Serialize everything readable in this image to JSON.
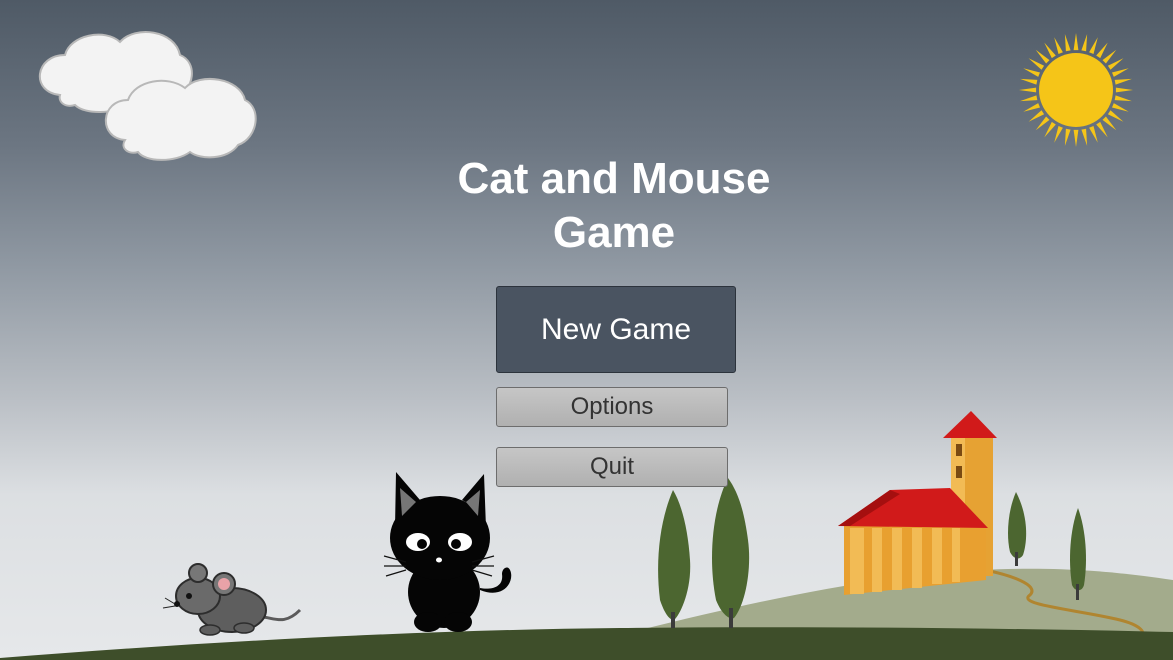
{
  "game": {
    "title_line1": "Cat and Mouse",
    "title_line2": "Game"
  },
  "menu": {
    "new_game_label": "New Game",
    "options_label": "Options",
    "quit_label": "Quit"
  },
  "colors": {
    "sky_top": "#4f5a66",
    "sky_bottom": "#e6e8ea",
    "primary_button": "#4a5461",
    "secondary_button": "#bdbdbd",
    "sun": "#f5c518",
    "roof": "#d11a1a",
    "building": "#e8a030",
    "hill": "#a3ab8c",
    "ground": "#3e4e2a",
    "tree": "#4c6630"
  }
}
